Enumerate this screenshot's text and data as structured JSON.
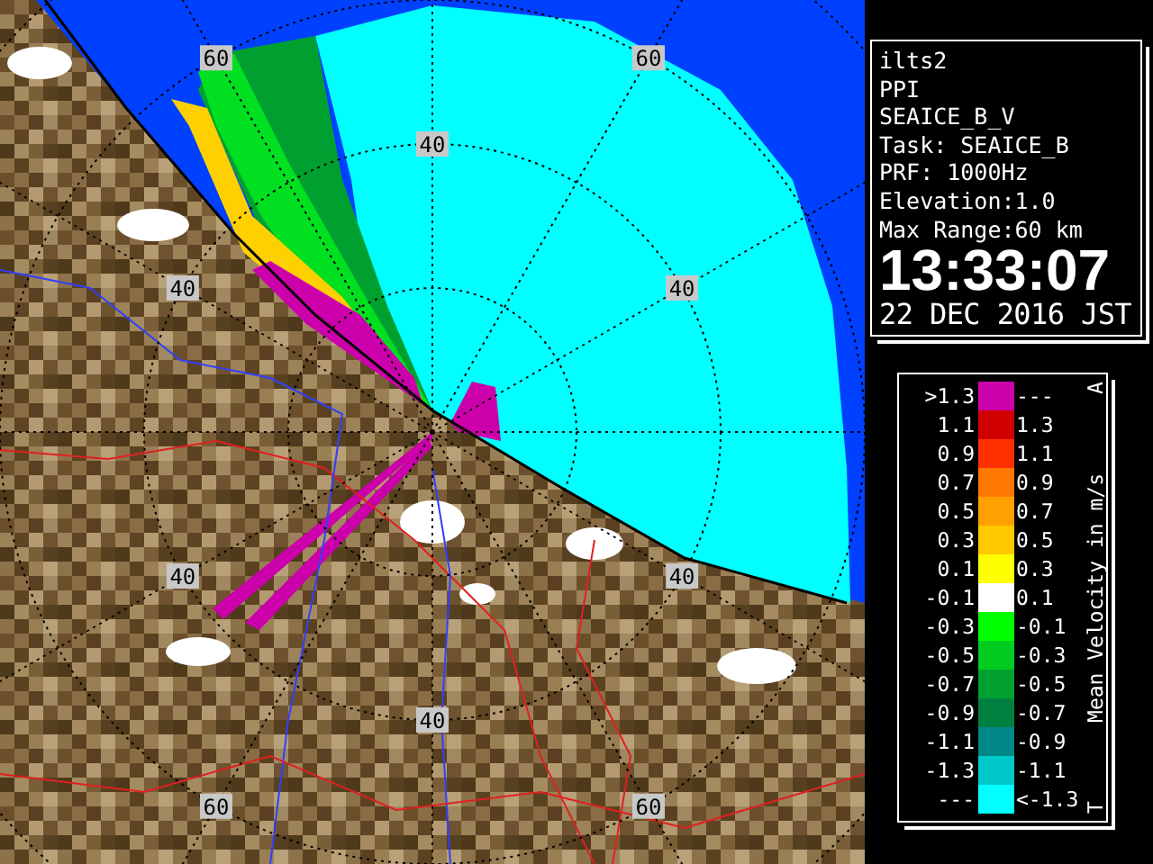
{
  "radar_image": {
    "range_labels": [
      {
        "text": "60"
      },
      {
        "text": "60"
      },
      {
        "text": "40"
      },
      {
        "text": "40"
      },
      {
        "text": "40"
      },
      {
        "text": "40"
      },
      {
        "text": "40"
      },
      {
        "text": "40"
      },
      {
        "text": "60"
      },
      {
        "text": "60"
      }
    ]
  },
  "info_panel": {
    "lines": [
      "ilts2",
      "PPI",
      "SEAICE_B_V",
      "Task: SEAICE_B",
      "PRF: 1000Hz",
      "Elevation:1.0",
      "Max Range:60 km"
    ],
    "time": "13:33:07",
    "date": "22 DEC 2016 JST"
  },
  "legend": {
    "title": "Mean Velocity in m/s",
    "top_mark": "A",
    "bottom_mark": "T",
    "entries": [
      {
        "label": ">1.3",
        "upper": "---",
        "color": "#cc00aa"
      },
      {
        "label": "1.1",
        "upper": "1.3",
        "color": "#d00000"
      },
      {
        "label": "0.9",
        "upper": "1.1",
        "color": "#ff3000"
      },
      {
        "label": "0.7",
        "upper": "0.9",
        "color": "#ff7800"
      },
      {
        "label": "0.5",
        "upper": "0.7",
        "color": "#ffa000"
      },
      {
        "label": "0.3",
        "upper": "0.5",
        "color": "#ffc800"
      },
      {
        "label": "0.1",
        "upper": "0.3",
        "color": "#ffff00"
      },
      {
        "label": "-0.1",
        "upper": "0.1",
        "color": "#ffffff"
      },
      {
        "label": "-0.3",
        "upper": "-0.1",
        "color": "#00ff00"
      },
      {
        "label": "-0.5",
        "upper": "-0.3",
        "color": "#00cc20"
      },
      {
        "label": "-0.7",
        "upper": "-0.5",
        "color": "#00a030"
      },
      {
        "label": "-0.9",
        "upper": "-0.7",
        "color": "#008040"
      },
      {
        "label": "-1.1",
        "upper": "-0.9",
        "color": "#008888"
      },
      {
        "label": "-1.3",
        "upper": "-1.1",
        "color": "#00c8c8"
      },
      {
        "label": "---",
        "upper": "<-1.3",
        "color": "#00ffff"
      }
    ]
  }
}
